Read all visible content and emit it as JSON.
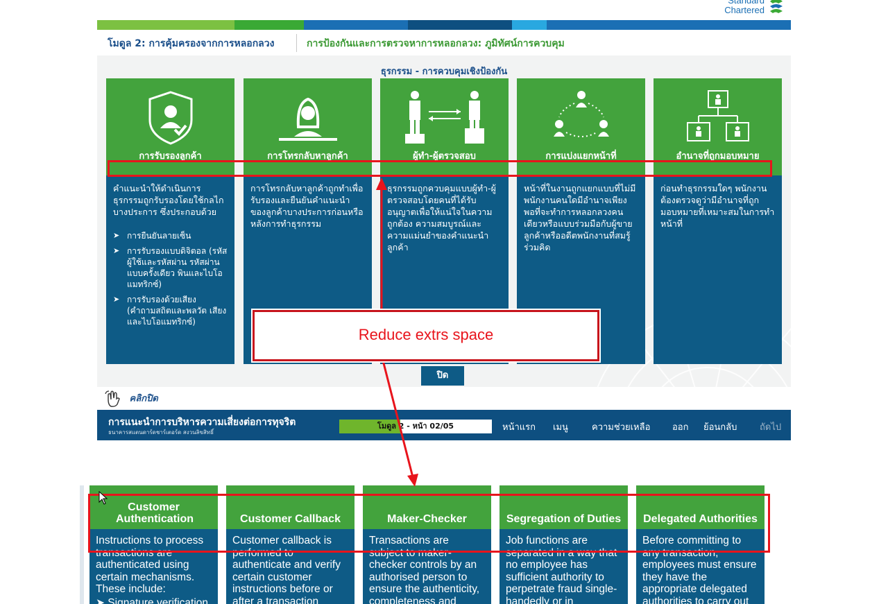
{
  "logo": {
    "line1": "Standard",
    "line2": "Chartered"
  },
  "module_bar": {
    "module": "โมดูล 2: การคุ้มครองจากการหลอกลวง",
    "topic": "การป้องกันและการตรวจหาการหลอกลวง: ภูมิทัศน์การควบคุม"
  },
  "section_title": "ธุรกรรม - การควบคุมเชิงป้องกัน",
  "cards": [
    {
      "title": "การรับรองลูกค้า",
      "body": "คำแนะนำให้ดำเนินการธุรกรรมถูกรับรองโดยใช้กลไกบางประการ ซึ่งประกอบด้วย",
      "bullets": [
        "การยืนยันลายเซ็น",
        "การรับรองแบบดิจิตอล (รหัสผู้ใช้และรหัสผ่าน รหัสผ่านแบบครั้งเดียว พินและไบโอแมทริกซ์)",
        "การรับรองด้วยเสียง (คำถามสถิตและพลวัต เสียงและไบโอแมทริกซ์)"
      ]
    },
    {
      "title": "การโทรกลับหาลูกค้า",
      "body": "การโทรกลับหาลูกค้าถูกทำเพื่อรับรองและยืนยันคำแนะนำของลูกค้าบางประการก่อนหรือหลังการทำธุรกรรม"
    },
    {
      "title": "ผู้ทำ-ผู้ตรวจสอบ",
      "body": "ธุรกรรมถูกควบคุมแบบผู้ทำ-ผู้ตรวจสอบโดยคนที่ได้รับอนุญาตเพื่อให้แน่ใจในความถูกต้อง ความสมบูรณ์และความแม่นยำของคำแนะนำลูกค้า"
    },
    {
      "title": "การแบ่งแยกหน้าที่",
      "body": "หน้าที่ในงานถูกแยกแบบที่ไม่มีพนักงานคนใดมีอำนาจเพียงพอที่จะทำการหลอกลวงคนเดียวหรือแบบร่วมมือกับผู้ขาย ลูกค้าหรืออดีตพนักงานที่สมรู้ร่วมคิด"
    },
    {
      "title": "อำนาจที่ถูกมอบหมาย",
      "body": "ก่อนทำธุรกรรมใดๆ พนักงานต้องตรวจดูว่ามีอำนาจที่ถูกมอบหมายที่เหมาะสมในการทำหน้าที่"
    }
  ],
  "close_button": "ปิด",
  "click_close": "คลิกปิด",
  "footer": {
    "title": "การแนะนำการบริหารความเสี่ยงต่อการทุจริต",
    "subtitle": "ธนาคารสแตนดาร์ดชาร์เตอร์ด สงวนลิขสิทธิ์",
    "progress_label": "โมดูล 2 - หน้า 02/05",
    "progress": 0.4,
    "nav": [
      "หน้าแรก",
      "เมนู",
      "ความช่วยเหลือ",
      "ออก",
      "ย้อนกลับ",
      "ถัดไป"
    ]
  },
  "annotation": {
    "text": "Reduce extrs space",
    "color": "#e8141c"
  },
  "preview_cards": [
    {
      "title": "Customer Authentication",
      "body": "Instructions to process transactions are authenticated using certain mechanisms. These include:",
      "bullet": "Signature verification"
    },
    {
      "title": "Customer Callback",
      "body": "Customer callback is performed to authenticate and verify certain customer instructions before or after a transaction"
    },
    {
      "title": "Maker-Checker",
      "body": "Transactions are subject to maker-checker controls by an authorised person to ensure the authenticity, completeness and"
    },
    {
      "title": "Segregation of Duties",
      "body": "Job functions are separated in a way that no employee has sufficient authority to perpetrate fraud single-handedly or in"
    },
    {
      "title": "Delegated Authorities",
      "body": "Before committing to any transaction, employees must ensure they have the appropriate delegated authorities to carry out"
    }
  ],
  "colors": {
    "green": "#43a33d",
    "blue": "#0e5b86",
    "navy": "#0e4f80",
    "annotation_red": "#e8141c"
  }
}
